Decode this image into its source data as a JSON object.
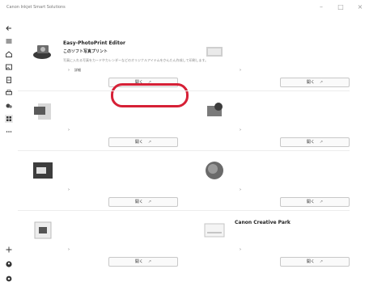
{
  "window": {
    "title": "Canon Inkjet Smart Solutions",
    "controls": [
      "–",
      "□",
      "×"
    ]
  },
  "sidebar": {
    "top_icons": [
      "back-arrow-icon",
      "menu-icon",
      "home-icon",
      "photo-icon",
      "document-icon",
      "printer-icon",
      "scan-icon",
      "apps-grid-icon",
      "more-icon"
    ],
    "bottom_icons": [
      "add-icon",
      "account-icon",
      "settings-icon"
    ]
  },
  "cards": [
    {
      "title": "Easy-PhotoPrint Editor",
      "subtitle": "このソフト写真プリント",
      "description": "写真に入れる写真をカードやカレンダーなどのオリジナルアイテムをかんたん作成して印刷します。",
      "detail": "詳細",
      "button": "開く"
    },
    {
      "title": "",
      "subtitle": "",
      "description": "",
      "detail": "",
      "button": "開く"
    },
    {
      "title": "",
      "subtitle": "",
      "description": "",
      "detail": "",
      "button": "開く"
    },
    {
      "title": "",
      "subtitle": "",
      "description": "",
      "detail": "",
      "button": "開く"
    },
    {
      "title": "",
      "subtitle": "",
      "description": "",
      "detail": "",
      "button": "開く"
    },
    {
      "title": "",
      "subtitle": "",
      "description": "",
      "detail": "",
      "button": "開く"
    },
    {
      "title": "",
      "subtitle": "",
      "description": "",
      "detail": "",
      "button": "開く"
    },
    {
      "title": "Canon Creative Park",
      "subtitle": "",
      "description": "",
      "detail": "",
      "button": "開く"
    }
  ],
  "colors": {
    "highlight": "#d62036",
    "button_border": "#c8c8c8"
  }
}
